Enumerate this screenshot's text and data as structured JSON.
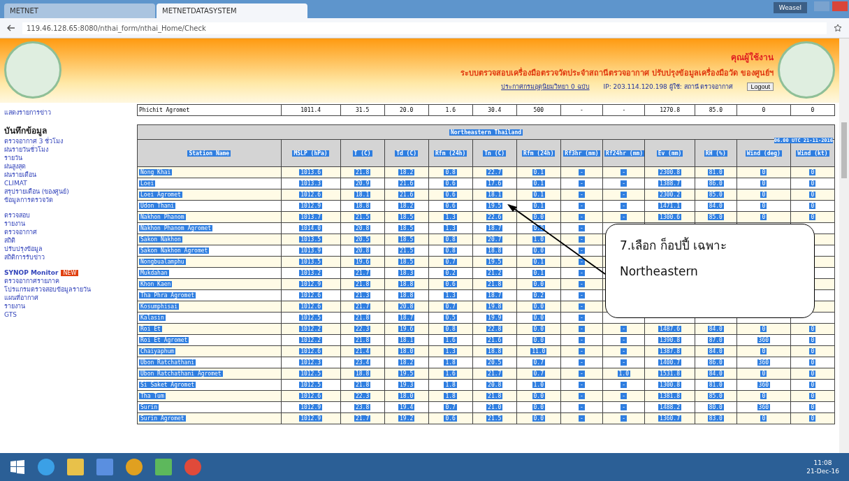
{
  "browser": {
    "tabs": [
      {
        "label": "METNET",
        "selected": false
      },
      {
        "label": "METNETDATASYSTEM",
        "selected": true
      }
    ],
    "user_badge": "Weasel",
    "address": "119.46.128.65:8080/nthai_form/nthai_Home/Check"
  },
  "header": {
    "greeting": "คุณผู้ใช้งาน",
    "title": "ระบบตรวจสอบเครื่องมือตรวจวัดประจำสถานีตรวจอากาศ ปรับปรุงข้อมูลเครื่องมือวัด ของศูนย์ฯ",
    "notice_link": "ประกาศกรมอุตุนิยมวิทยา 0 ฉบับ",
    "session_info": "IP: 203.114.120.198 ผู้ใช้: สถานี ตรวจอากาศ",
    "logout": "Logout"
  },
  "sidebar": {
    "top_link": "แสดงรายการข่าว",
    "heading": "บันทึกข้อมูล",
    "groups": [
      {
        "items": [
          {
            "label": "ตรวจอากาศ 3 ชั่วโมง"
          },
          {
            "label": "ฝนรายวันชั่วโมง"
          },
          {
            "label": "รายวัน"
          },
          {
            "label": "ฝนสูงสุด"
          },
          {
            "label": "ฝนรายเดือน"
          },
          {
            "label": "CLIMAT"
          },
          {
            "label": "สรุปรายเดือน (ของศูนย์)"
          },
          {
            "label": "ข้อมูลการตรวจวัด"
          }
        ]
      },
      {
        "items": [
          {
            "label": "ตรวจสอบ"
          },
          {
            "label": "รายงาน"
          },
          {
            "label": "ตรวจอากาศ"
          },
          {
            "label": "สถิติ"
          },
          {
            "label": "ปรับปรุงข้อมูล"
          },
          {
            "label": "สถิติการรับข่าว"
          }
        ]
      },
      {
        "items": [
          {
            "label": "SYNOP Monitor",
            "badge": "NEW",
            "bold": true
          },
          {
            "label": "ตรวจอากาศรายภาค"
          },
          {
            "label": "โปรแกรมตรวจสอบข้อมูลรายวัน"
          },
          {
            "label": "แผนที่อากาศ"
          },
          {
            "label": "รายงาน"
          },
          {
            "label": "GTS"
          }
        ]
      }
    ]
  },
  "previous_row": {
    "cells": [
      "Phichit Agromet",
      "1011.4",
      "31.5",
      "20.0",
      "1.6",
      "30.4",
      "500",
      "-",
      "-",
      "1270.8",
      "85.0",
      "0",
      "0"
    ]
  },
  "table": {
    "selected": true,
    "region": "Northeastern Thailand",
    "time": "06.00 UTC 21-11-2016",
    "columns": [
      "Station Name",
      "MSLP (hPa)",
      "T (C)",
      "Td (C)",
      "Rfm (24h)",
      "Tn (C)",
      "Rfm (24h)",
      "Rf3hr (mm)",
      "Rf24hr (mm)",
      "Ev (mm)",
      "RH (%)",
      "Wind (deg)",
      "Wind (kt)"
    ],
    "rows": [
      [
        "Nong Khai",
        "1013.6",
        "21.8",
        "18.2",
        "0.8",
        "22.7",
        "0.1",
        "-",
        "-",
        "2300.8",
        "81.0",
        "0",
        "0"
      ],
      [
        "Loei",
        "1013.3",
        "20.9",
        "21.6",
        "0.6",
        "17.6",
        "0.1",
        "-",
        "-",
        "1388.7",
        "86.0",
        "0",
        "0"
      ],
      [
        "Loei Agromet",
        "1012.6",
        "18.1",
        "21.6",
        "0.6",
        "18.1",
        "0.1",
        "-",
        "-",
        "2300.2",
        "85.0",
        "0",
        "0"
      ],
      [
        "Udon Thani",
        "1012.9",
        "18.8",
        "18.2",
        "0.6",
        "19.5",
        "0.1",
        "-",
        "-",
        "1471.1",
        "84.0",
        "0",
        "0"
      ],
      [
        "Nakhon Phanom",
        "1013.7",
        "21.5",
        "18.5",
        "1.3",
        "22.6",
        "0.0",
        "-",
        "-",
        "1300.6",
        "85.0",
        "0",
        "0"
      ],
      [
        "Nakhon Phanom Agromet",
        "1014.0",
        "20.8",
        "18.5",
        "1.3",
        "18.7",
        "0.0",
        "-",
        null,
        null,
        null,
        null,
        null
      ],
      [
        "Sakon Nakhon",
        "1013.5",
        "20.5",
        "18.5",
        "0.8",
        "20.7",
        "1.0",
        "-",
        null,
        null,
        null,
        null,
        null
      ],
      [
        "Sakon Nakhon Agromet",
        "1013.9",
        "20.8",
        "21.5",
        "0.8",
        "18.8",
        "0.0",
        "-",
        null,
        null,
        null,
        null,
        null
      ],
      [
        "Nongbualamphu",
        "1013.5",
        "19.6",
        "18.5",
        "0.7",
        "19.5",
        "0.1",
        "-",
        null,
        null,
        null,
        null,
        null
      ],
      [
        "Mukdahan",
        "1013.2",
        "21.7",
        "18.3",
        "0.2",
        "21.2",
        "0.1",
        "-",
        null,
        null,
        null,
        null,
        null
      ],
      [
        "Khon Kaen",
        "1012.9",
        "21.8",
        "18.8",
        "0.6",
        "21.8",
        "0.0",
        "-",
        null,
        null,
        null,
        null,
        null
      ],
      [
        "Tha Phra Agromet",
        "1012.6",
        "21.3",
        "18.8",
        "1.3",
        "18.7",
        "0.2",
        "-",
        null,
        null,
        null,
        null,
        null
      ],
      [
        "Kosumphisai",
        "1012.6",
        "21.7",
        "20.8",
        "0.7",
        "19.8",
        "0.0",
        "-",
        null,
        null,
        null,
        null,
        null
      ],
      [
        "Kalasin",
        "1012.5",
        "21.8",
        "18.7",
        "0.5",
        "19.9",
        "0.0",
        "-",
        null,
        null,
        null,
        null,
        null
      ],
      [
        "Roi Et",
        "1012.2",
        "22.3",
        "19.6",
        "0.8",
        "22.8",
        "0.0",
        "-",
        "-",
        "1487.6",
        "84.0",
        "0",
        "0"
      ],
      [
        "Roi Et Agromet",
        "1012.2",
        "21.8",
        "18.1",
        "1.6",
        "21.6",
        "0.0",
        "-",
        "-",
        "1390.8",
        "87.0",
        "360",
        "0"
      ],
      [
        "Chaiyaphum",
        "1012.6",
        "21.4",
        "18.0",
        "1.3",
        "18.8",
        "11.0",
        "-",
        "-",
        "1387.8",
        "84.0",
        "0",
        "0"
      ],
      [
        "Ubon Ratchathani",
        "1012.3",
        "23.4",
        "18.2",
        "1.8",
        "20.5",
        "0.7",
        "-",
        "-",
        "1400.7",
        "86.0",
        "360",
        "0"
      ],
      [
        "Ubon Ratchathani Agromet",
        "1012.5",
        "18.8",
        "19.5",
        "1.6",
        "21.7",
        "0.7",
        "-",
        "1.0",
        "1531.8",
        "84.0",
        "0",
        "0"
      ],
      [
        "Si Saket Agromet",
        "1012.5",
        "21.8",
        "19.3",
        "1.8",
        "20.8",
        "1.0",
        "-",
        "-",
        "1300.8",
        "81.0",
        "360",
        "0"
      ],
      [
        "Tha Tum",
        "1012.6",
        "22.3",
        "18.0",
        "1.8",
        "21.8",
        "0.0",
        "-",
        "-",
        "1381.8",
        "85.0",
        "0",
        "0"
      ],
      [
        "Surin",
        "1012.9",
        "23.8",
        "19.4",
        "0.7",
        "21.0",
        "0.0",
        "-",
        "-",
        "1488.2",
        "80.0",
        "360",
        "0"
      ],
      [
        "Surin Agromet",
        "1012.9",
        "21.7",
        "19.2",
        "0.6",
        "21.5",
        "0.0",
        "-",
        "-",
        "1360.7",
        "83.0",
        "0",
        "0"
      ]
    ]
  },
  "callout": {
    "line1": "7.เลือก ก็อปปี้ เฉพาะ",
    "line2": "Northeastern"
  },
  "taskbar": {
    "time": "11:08",
    "date": "21-Dec-16"
  }
}
